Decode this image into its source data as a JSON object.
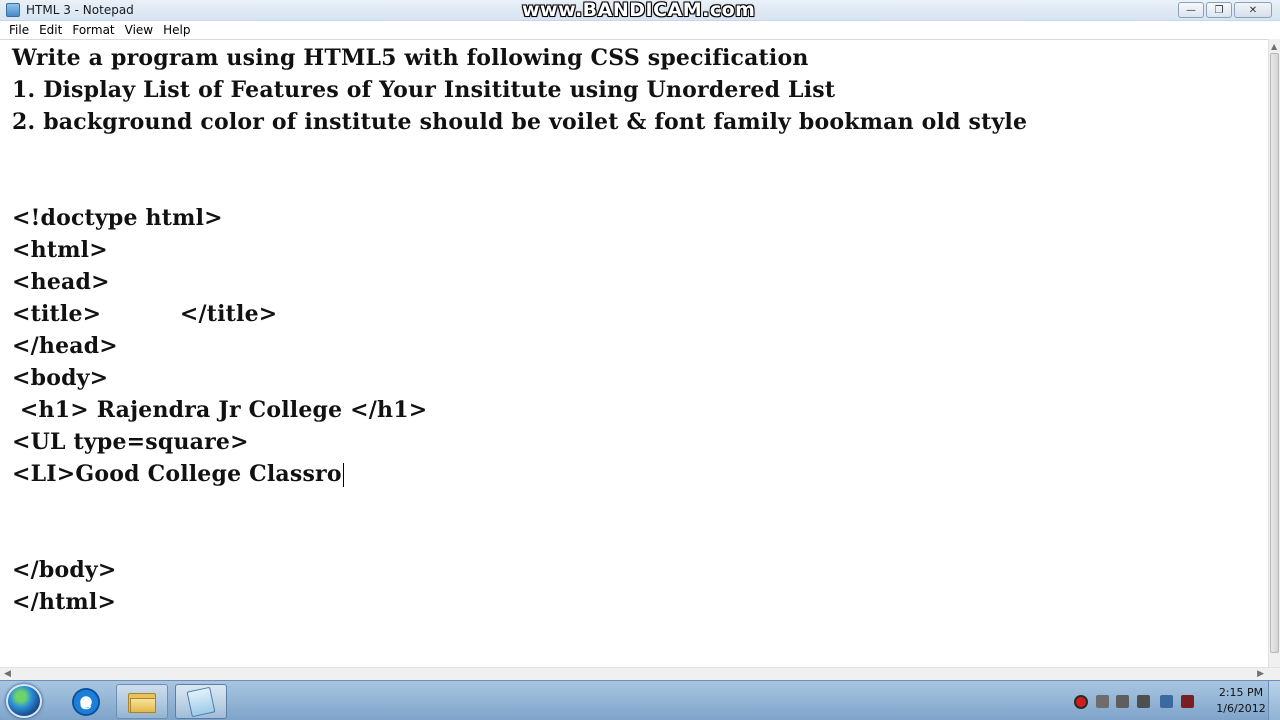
{
  "window": {
    "title": "HTML 3 - Notepad",
    "watermark": "www.BANDICAM.com",
    "minimize_label": "—",
    "maximize_label": "❐",
    "close_label": "✕"
  },
  "menu": {
    "items": [
      "File",
      "Edit",
      "Format",
      "View",
      "Help"
    ]
  },
  "editor": {
    "lines": [
      "Write a program using HTML5 with following CSS specification",
      "1. Display List of Features of Your Insititute using Unordered List",
      "2. background color of institute should be voilet & font family bookman old style",
      "",
      "",
      "<!doctype html>",
      "<html>",
      "<head>",
      "<title>          </title>",
      "</head>",
      "<body>",
      " <h1> Rajendra Jr College </h1>",
      "<UL type=square>",
      "<LI>Good College Classro",
      "",
      "",
      "</body>",
      "</html>"
    ]
  },
  "taskbar": {
    "start_icon": "windows-orb-icon",
    "pinned": [
      "internet-explorer-icon",
      "windows-explorer-icon",
      "notepad-icon"
    ],
    "tray_icons": [
      "record-icon",
      "network-icon",
      "action-center-icon",
      "volume-icon",
      "flag-icon",
      "usb-icon"
    ],
    "clock_time": "2:15 PM",
    "clock_date": "1/6/2012"
  }
}
